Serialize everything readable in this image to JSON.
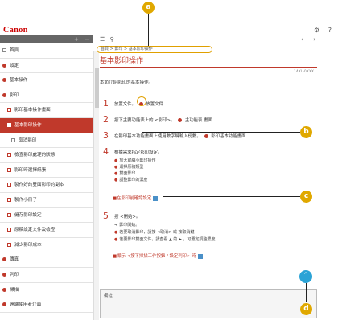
{
  "logo": "Canon",
  "topbar": {
    "gear_icon": "gear-icon",
    "help_icon": "question-icon"
  },
  "sidebar": {
    "head_add": "+",
    "head_remove": "−",
    "items": [
      {
        "label": "首頁",
        "icon": "doc",
        "level": 0
      },
      {
        "label": "設定",
        "icon": "dot",
        "level": 0
      },
      {
        "label": "基本操作",
        "icon": "dot",
        "level": 0
      },
      {
        "label": "影印",
        "icon": "dot",
        "level": 0
      },
      {
        "label": "影印基本操作畫面",
        "icon": "sq",
        "level": 1
      },
      {
        "label": "基本影印操作",
        "icon": "sq",
        "level": 1,
        "active": true
      },
      {
        "label": "取消影印",
        "icon": "doc",
        "level": 2
      },
      {
        "label": "檢查影印處理的狀態",
        "icon": "sq",
        "level": 1
      },
      {
        "label": "影印時選擇紙張",
        "icon": "sq",
        "level": 1
      },
      {
        "label": "製作好的雙面影印的副本",
        "icon": "sq",
        "level": 1
      },
      {
        "label": "製作小冊子",
        "icon": "sq",
        "level": 1
      },
      {
        "label": "儲存影印設定",
        "icon": "sq",
        "level": 1
      },
      {
        "label": "原稿設定文件及檢查",
        "icon": "sq",
        "level": 1
      },
      {
        "label": "減少影印成本",
        "icon": "sq",
        "level": 1
      },
      {
        "label": "傳真",
        "icon": "dot",
        "level": 0
      },
      {
        "label": "列印",
        "icon": "dot",
        "level": 0
      },
      {
        "label": "掃描",
        "icon": "dot",
        "level": 0
      },
      {
        "label": "遠端使用者介面",
        "icon": "dot",
        "level": 0
      }
    ]
  },
  "main": {
    "list_icon": "list-icon",
    "search_icon": "search-icon",
    "breadcrumb": "首頁 > 影印 > 基本影印操作",
    "title": "基本影印操作",
    "code": "14XL-0XXX",
    "intro": "本節介紹影印的基本操作。",
    "steps": [
      {
        "num": "1",
        "text": "放置文件。",
        "suffix": "放置文件"
      },
      {
        "num": "2",
        "text": "按下主要功能表上的 <影印>。",
        "suffix": "主功能表 畫面"
      },
      {
        "num": "3",
        "text": "在影印基本功能畫面上使用數字鍵輸入份數。",
        "suffix": "影印基本功能畫面"
      },
      {
        "num": "4",
        "text": "根據需求指定影印設定。"
      },
      {
        "num": "5",
        "text": "按 <開始>。"
      }
    ],
    "step4_subs": [
      "放大或縮小影印操作",
      "選擇原稿類型",
      "雙面影印",
      "調整影印的濃度"
    ],
    "link_confirm": "■在影印前確認設定",
    "step5_subs": [
      "影印開始。",
      "若要取消影印，請按 <取消> 或 按取消鍵",
      "若要影印雙面文件，請查看 ▲ 的 ▶ ，可選定調整濃度。"
    ],
    "link_next": "■顯示 <按下掃描工作按鈕 / 設定列印> 時",
    "note_title": "備註",
    "scroll_top_label": "⌃"
  },
  "callouts": [
    "a",
    "b",
    "c",
    "d"
  ]
}
